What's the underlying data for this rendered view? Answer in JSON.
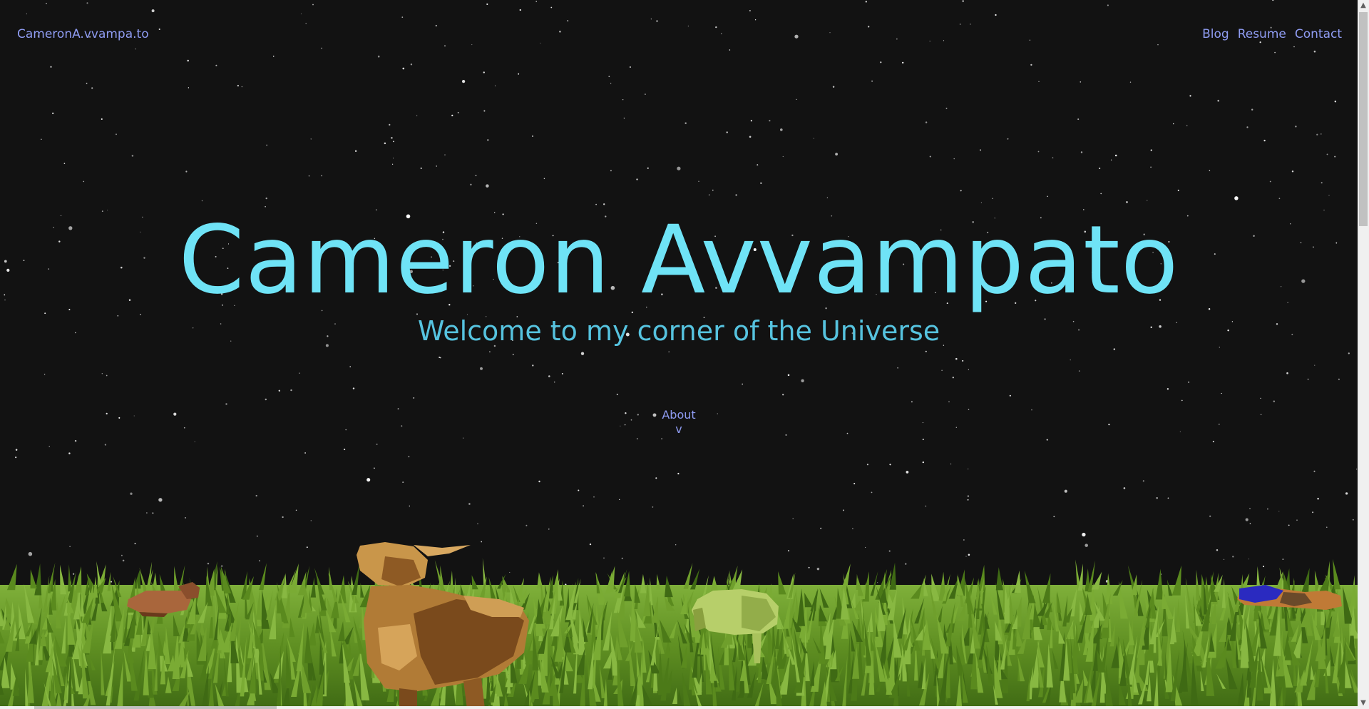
{
  "header": {
    "site_name": "CameronA.vvampa.to",
    "nav": [
      {
        "label": "Blog"
      },
      {
        "label": "Resume"
      },
      {
        "label": "Contact"
      }
    ]
  },
  "hero": {
    "title": "Cameron Avvampato",
    "subtitle": "Welcome to my corner of the Universe"
  },
  "about": {
    "label": "About",
    "arrow": "v"
  },
  "scene": {
    "sky_color": "#121212",
    "star_color": "#ffffff",
    "grass_color": "#6a9a2a",
    "animals": [
      {
        "name": "brown-sheep",
        "color": "#a9663c"
      },
      {
        "name": "tan-sheep",
        "color": "#c9964a"
      },
      {
        "name": "green-sheep",
        "color": "#b7cf6a"
      },
      {
        "name": "blue-orange-sheep",
        "color": "#2a2ac0"
      }
    ]
  },
  "scrollbar": {
    "up_icon": "▲",
    "down_icon": "▼"
  }
}
